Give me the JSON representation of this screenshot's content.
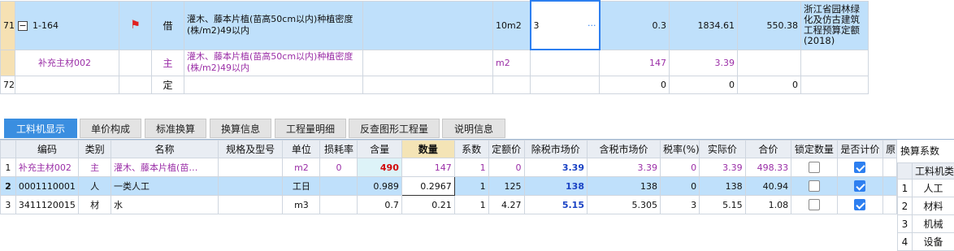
{
  "top_rows": [
    {
      "row": "71",
      "code": "1-164",
      "flag": "借",
      "name": "灌木、藤本片植(苗高50cm以内)种植密度(株/m2)49以内",
      "unit": "10m2",
      "qty": "3",
      "qty_btn": "···",
      "a": "0.3",
      "b": "1834.61",
      "c": "550.38",
      "note": "浙江省园林绿化及仿古建筑工程预算定额(2018)"
    },
    {
      "row": "",
      "code": "补充主材002",
      "flag": "主",
      "name": "灌木、藤本片植(苗高50cm以内)种植密度(株/m2)49以内",
      "unit": "m2",
      "qty": "",
      "a": "147",
      "b": "3.39",
      "c": "",
      "note": ""
    },
    {
      "row": "72",
      "code": "",
      "flag": "定",
      "name": "",
      "unit": "",
      "qty": "",
      "a": "0",
      "b": "0",
      "c": "0",
      "note": ""
    }
  ],
  "tabs": [
    "工料机显示",
    "单价构成",
    "标准换算",
    "换算信息",
    "工程量明细",
    "反查图形工程量",
    "说明信息"
  ],
  "grid_headers": [
    "编码",
    "类别",
    "名称",
    "规格及型号",
    "单位",
    "损耗率",
    "含量",
    "数量",
    "系数",
    "定额价",
    "除税市场价",
    "含税市场价",
    "税率(%)",
    "实际价",
    "合价",
    "锁定数量",
    "是否计价",
    "原"
  ],
  "grid_rows": [
    {
      "n": "1",
      "code": "补充主材002",
      "cat": "主",
      "name": "灌木、藤本片植(苗…",
      "spec": "",
      "unit": "m2",
      "loss": "0",
      "content": "490",
      "qty": "147",
      "coef": "1",
      "quota": "0",
      "ex_tax": "3.39",
      "in_tax": "3.39",
      "rate": "0",
      "actual": "3.39",
      "total": "498.33"
    },
    {
      "n": "2",
      "code": "0001110001",
      "cat": "人",
      "name": "一类人工",
      "spec": "",
      "unit": "工日",
      "loss": "",
      "content": "0.989",
      "qty": "0.2967",
      "coef": "1",
      "quota": "125",
      "ex_tax": "138",
      "in_tax": "138",
      "rate": "0",
      "actual": "138",
      "total": "40.94"
    },
    {
      "n": "3",
      "code": "3411120015",
      "cat": "材",
      "name": "水",
      "spec": "",
      "unit": "m3",
      "loss": "",
      "content": "0.7",
      "qty": "0.21",
      "coef": "1",
      "quota": "4.27",
      "ex_tax": "5.15",
      "in_tax": "5.305",
      "rate": "3",
      "actual": "5.15",
      "total": "1.08"
    }
  ],
  "side": {
    "title": "换算系数",
    "header": "工料机类",
    "rows": [
      {
        "n": "1",
        "v": "人工"
      },
      {
        "n": "2",
        "v": "材料"
      },
      {
        "n": "3",
        "v": "机械"
      },
      {
        "n": "4",
        "v": "设备"
      }
    ]
  }
}
